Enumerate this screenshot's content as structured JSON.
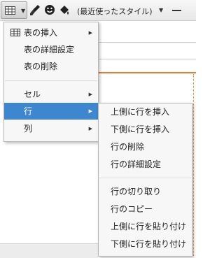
{
  "toolbar": {
    "table_button_icon": "table-icon",
    "brush_icon": "eraser-brush-icon",
    "smiley_icon": "smiley-icon",
    "bucket_icon": "paint-bucket-icon",
    "style_select_value": "(最近使ったスタイル)",
    "hr_icon": "horizontal-rule-icon",
    "colors": {
      "bar_top": "#f7f7f7",
      "bar_bottom": "#e7e7e7"
    }
  },
  "table_menu": {
    "items": [
      {
        "label": "表の挿入",
        "icon": "table-grid-icon",
        "has_submenu": true
      },
      {
        "label": "表の詳細設定",
        "has_submenu": false
      },
      {
        "label": "表の削除",
        "has_submenu": false
      },
      {
        "label": "セル",
        "has_submenu": true
      },
      {
        "label": "行",
        "has_submenu": true,
        "active": true
      },
      {
        "label": "列",
        "has_submenu": true
      }
    ]
  },
  "row_submenu": {
    "items": [
      {
        "label": "上側に行を挿入"
      },
      {
        "label": "下側に行を挿入"
      },
      {
        "label": "行の削除"
      },
      {
        "label": "行の詳細設定"
      },
      {
        "label": "行の切り取り"
      },
      {
        "label": "行のコピー"
      },
      {
        "label": "上側に行を貼り付け"
      },
      {
        "label": "下側に行を貼り付け"
      }
    ]
  },
  "colors": {
    "highlight": "#3d86d0",
    "accent_rule": "#f07a2c",
    "menu_bg": "#f7f7f7"
  }
}
